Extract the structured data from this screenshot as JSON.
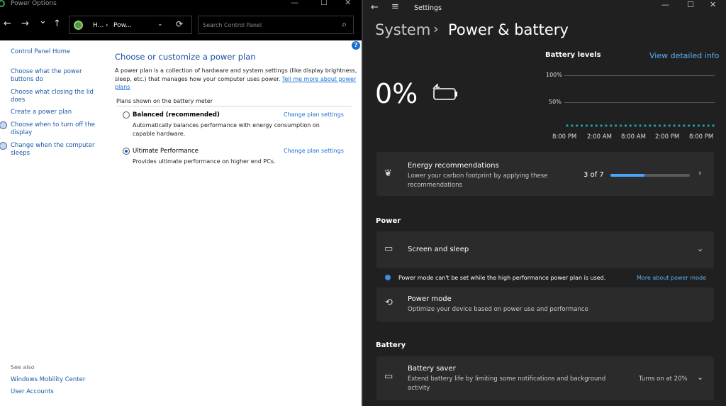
{
  "control_panel": {
    "window_title": "Power Options",
    "nav": {
      "back": "←",
      "forward": "→",
      "recent": "⌄",
      "up": "↑"
    },
    "address": {
      "part1": "H...",
      "sep": "›",
      "part2": "Pow...",
      "dropdown": "⌄",
      "refresh": "⟳"
    },
    "search_placeholder": "Search Control Panel",
    "sidebar": [
      {
        "label": "Control Panel Home"
      },
      {
        "label": "Choose what the power buttons do"
      },
      {
        "label": "Choose what closing the lid does"
      },
      {
        "label": "Create a power plan"
      },
      {
        "label": "Choose when to turn off the display"
      },
      {
        "label": "Change when the computer sleeps"
      }
    ],
    "heading": "Choose or customize a power plan",
    "description": "A power plan is a collection of hardware and system settings (like display brightness, sleep, etc.) that manages how your computer uses power.",
    "description_link": "Tell me more about power plans",
    "plans_label": "Plans shown on the battery meter",
    "plans": [
      {
        "name": "Balanced (recommended)",
        "desc": "Automatically balances performance with energy consumption on capable hardware.",
        "link": "Change plan settings",
        "selected": false
      },
      {
        "name": "Ultimate Performance",
        "desc": "Provides ultimate performance on higher end PCs.",
        "link": "Change plan settings",
        "selected": true
      }
    ],
    "see_also": "See also",
    "see_also_links": [
      "Windows Mobility Center",
      "User Accounts"
    ]
  },
  "settings": {
    "window_title": "Settings",
    "breadcrumb": {
      "parent": "System",
      "sep": "›",
      "current": "Power & battery"
    },
    "battery_percent": "0%",
    "battery_levels": {
      "title": "Battery levels",
      "link": "View detailed info",
      "y_ticks": [
        "100%",
        "50%"
      ],
      "x_ticks": [
        "8:00 PM",
        "2:00 AM",
        "8:00 AM",
        "2:00 PM",
        "8:00 PM"
      ]
    },
    "chart_data": {
      "type": "line",
      "title": "Battery levels",
      "xlabel": "",
      "ylabel": "",
      "x_ticks": [
        "8:00 PM",
        "2:00 AM",
        "8:00 AM",
        "2:00 PM",
        "8:00 PM"
      ],
      "y_ticks": [
        "100%",
        "50%"
      ],
      "ylim": [
        0,
        100
      ],
      "series": [
        {
          "values": [
            0,
            0,
            0,
            0,
            0,
            0,
            0,
            0,
            0,
            0,
            0,
            0,
            0,
            0,
            0,
            0,
            0,
            0,
            0,
            0,
            0,
            0,
            0,
            0,
            0,
            0,
            0,
            0,
            0,
            0,
            0
          ]
        }
      ],
      "color": "#1fa1a6",
      "grid": true
    },
    "energy": {
      "title": "Energy recommendations",
      "subtitle_line1": "Lower your carbon footprint by applying these",
      "subtitle_line2": "recommendations",
      "count": "3 of 7",
      "progress": 0.43,
      "chevron": "›"
    },
    "power_section": "Power",
    "screen_sleep": {
      "title": "Screen and sleep",
      "chevron": "⌄"
    },
    "warning": {
      "text": "Power mode can't be set while the high performance power plan is used.",
      "link": "More about power mode"
    },
    "power_mode": {
      "title": "Power mode",
      "subtitle": "Optimize your device based on power use and performance"
    },
    "battery_section": "Battery",
    "battery_saver": {
      "title": "Battery saver",
      "subtitle_line1": "Extend battery life by limiting some notifications and background",
      "subtitle_line2": "activity",
      "status": "Turns on at 20%",
      "chevron": "⌄"
    }
  },
  "colors": {
    "accent": "#4aa2ff",
    "link_cp": "#1b6fd0",
    "chart_teal": "#1fa1a6",
    "dark_bg": "#202020",
    "card_bg": "#2b2b2b"
  }
}
